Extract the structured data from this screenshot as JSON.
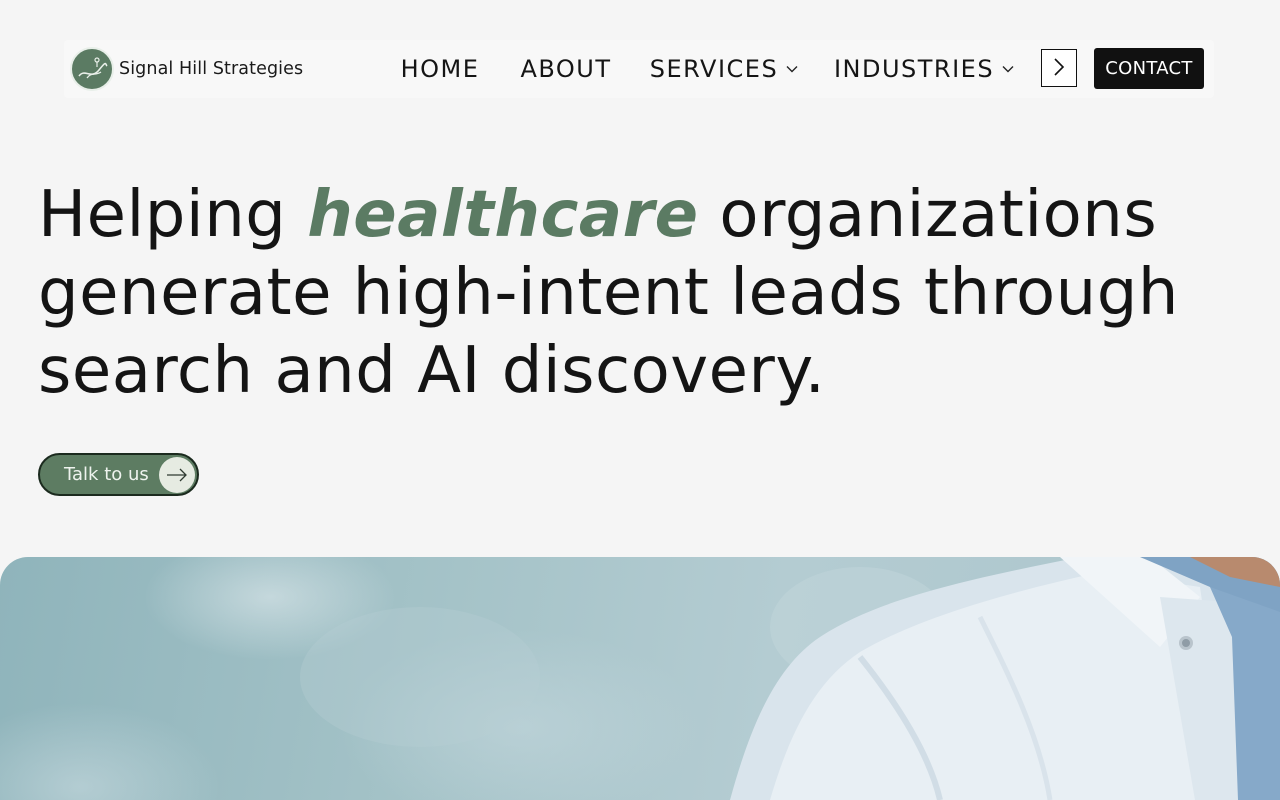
{
  "brand": {
    "name": "Signal Hill Strategies",
    "logo_icon": "hill-signal-logo-icon",
    "color": "#5b7b63"
  },
  "nav": {
    "items": [
      {
        "label": "HOME"
      },
      {
        "label": "ABOUT"
      },
      {
        "label": "SERVICES",
        "has_dropdown": true
      },
      {
        "label": "INDUSTRIES",
        "has_dropdown": true
      }
    ],
    "next_icon": "chevron-right-icon",
    "contact_label": "CONTACT"
  },
  "hero": {
    "headline_pre": "Helping ",
    "headline_accent": "healthcare",
    "headline_post": " organizations generate high-intent leads through search and AI discovery.",
    "cta_label": "Talk to us",
    "cta_icon": "arrow-right-icon"
  },
  "colors": {
    "accent": "#5b7b63",
    "background": "#f5f5f5",
    "contact_bg": "#111111"
  }
}
